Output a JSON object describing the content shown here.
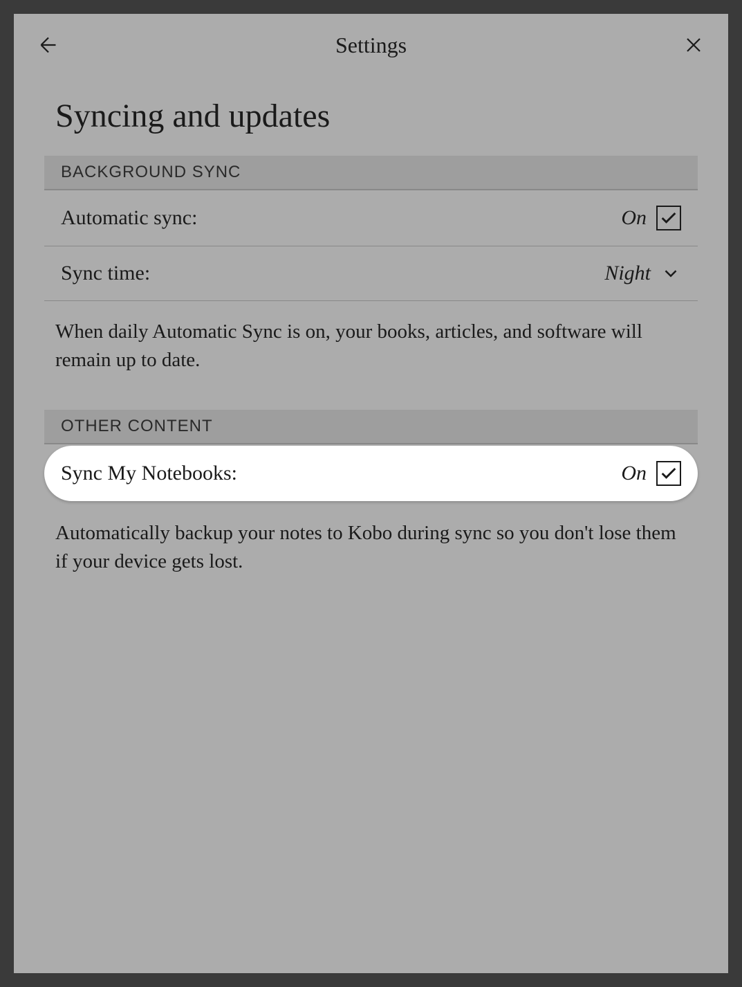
{
  "header": {
    "title": "Settings"
  },
  "page": {
    "title": "Syncing and updates"
  },
  "sections": {
    "background_sync": {
      "header": "BACKGROUND SYNC",
      "automatic_sync": {
        "label": "Automatic sync:",
        "value": "On",
        "checked": true
      },
      "sync_time": {
        "label": "Sync time:",
        "value": "Night"
      },
      "description": "When daily Automatic Sync is on, your books, articles, and software will remain up to date."
    },
    "other_content": {
      "header": "OTHER CONTENT",
      "sync_notebooks": {
        "label": "Sync My Notebooks:",
        "value": "On",
        "checked": true
      },
      "description": "Automatically backup your notes to Kobo during sync so you don't lose them if your device gets lost."
    }
  }
}
